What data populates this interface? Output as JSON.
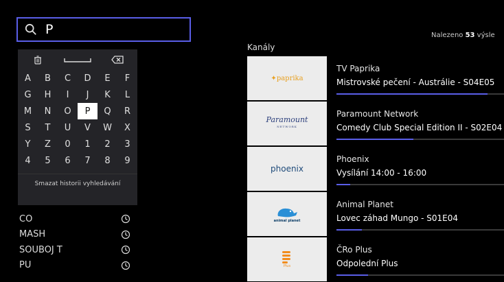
{
  "search": {
    "query": "P"
  },
  "keyboard": {
    "top_keys": [
      {
        "name": "trash-icon"
      },
      {
        "name": "space-key"
      },
      {
        "name": "backspace-icon"
      }
    ],
    "rows": [
      [
        "A",
        "B",
        "C",
        "D",
        "E",
        "F"
      ],
      [
        "G",
        "H",
        "I",
        "J",
        "K",
        "L"
      ],
      [
        "M",
        "N",
        "O",
        "P",
        "Q",
        "R"
      ],
      [
        "S",
        "T",
        "U",
        "V",
        "W",
        "X"
      ],
      [
        "Y",
        "Z",
        "0",
        "1",
        "2",
        "3"
      ],
      [
        "4",
        "5",
        "6",
        "7",
        "8",
        "9"
      ]
    ],
    "active_key": "P",
    "clear_history_label": "Smazat historii vyhledávání"
  },
  "history": {
    "items": [
      {
        "text": "CO"
      },
      {
        "text": "MASH"
      },
      {
        "text": "SOUBOJ T"
      },
      {
        "text": "PU"
      }
    ]
  },
  "results": {
    "found_prefix": "Nalezeno ",
    "found_count": "53",
    "found_suffix": " výsle",
    "section_title": "Kanály",
    "accent_color": "#5a5ee8",
    "channels": [
      {
        "name": "TV Paprika",
        "program": "Mistrovské pečení - Austrálie - S04E05",
        "progress": 0.9,
        "logo": "paprika"
      },
      {
        "name": "Paramount Network",
        "program": "Comedy Club Special Edition II - S02E04",
        "progress": 0.46,
        "logo": "Paramount"
      },
      {
        "name": "Phoenix",
        "program": "Vysílání 14:00 - 16:00",
        "progress": 0.08,
        "logo": "phoenix"
      },
      {
        "name": "Animal Planet",
        "program": "Lovec záhad Mungo - S01E04",
        "progress": 0.15,
        "logo": "animal planet"
      },
      {
        "name": "ČRo Plus",
        "program": "Odpolední Plus",
        "progress": 0.19,
        "logo": "Plus"
      }
    ]
  }
}
